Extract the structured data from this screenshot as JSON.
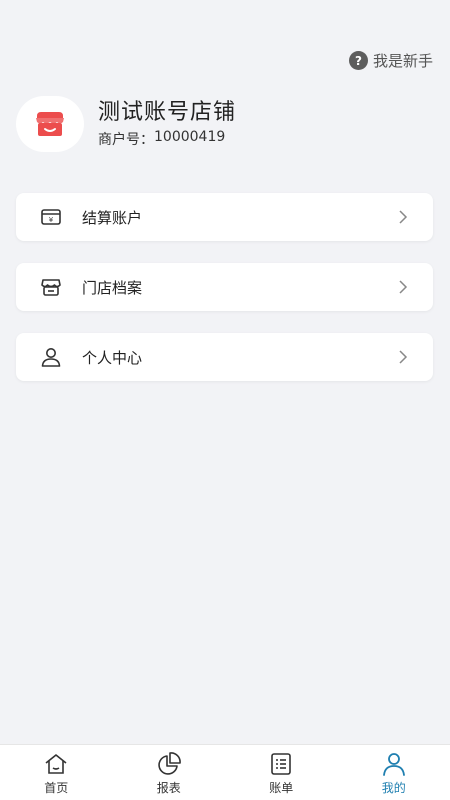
{
  "header": {
    "help_label": "我是新手",
    "help_icon": "question-circle-icon"
  },
  "profile": {
    "shop_name": "测试账号店铺",
    "merchant_label": "商户号：",
    "merchant_id": "10000419",
    "avatar_icon": "shop-icon",
    "avatar_color": "#ec4d4d"
  },
  "menu": [
    {
      "label": "结算账户",
      "icon": "wallet-icon"
    },
    {
      "label": "门店档案",
      "icon": "store-icon"
    },
    {
      "label": "个人中心",
      "icon": "user-icon"
    }
  ],
  "tabs": [
    {
      "label": "首页",
      "icon": "home-icon"
    },
    {
      "label": "报表",
      "icon": "pie-chart-icon"
    },
    {
      "label": "账单",
      "icon": "list-icon"
    },
    {
      "label": "我的",
      "icon": "person-icon",
      "active": true
    }
  ],
  "colors": {
    "accent": "#1f7fb0",
    "background": "#f2f3f6"
  }
}
